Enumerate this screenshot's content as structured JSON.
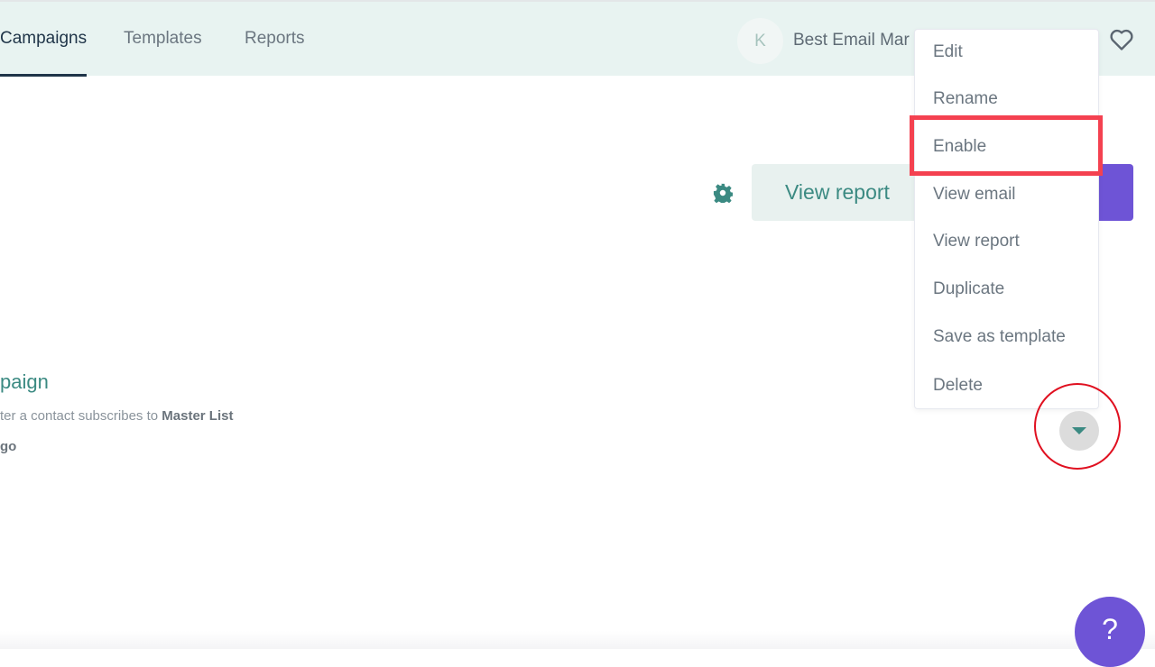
{
  "nav": {
    "tabs": [
      {
        "label": "Campaigns",
        "active": true
      },
      {
        "label": "Templates",
        "active": false
      },
      {
        "label": "Reports",
        "active": false
      }
    ]
  },
  "account": {
    "avatar_initial": "K",
    "name": "Best Email Mar"
  },
  "actions": {
    "view_report_label": "View report"
  },
  "campaign": {
    "title": "paign",
    "description_prefix": "ter a contact subscribes to ",
    "description_list": "Master List",
    "time": "go"
  },
  "dropdown_menu": {
    "items": [
      "Edit",
      "Rename",
      "Enable",
      "View email",
      "View report",
      "Duplicate",
      "Save as template",
      "Delete"
    ],
    "highlighted_item": "Enable"
  },
  "help": {
    "label": "?"
  },
  "colors": {
    "accent_teal": "#3b8a82",
    "brand_purple": "#6e54d6",
    "header_bg": "#e8f3f1",
    "highlight_red": "#f44150",
    "annotation_red": "#e01020"
  }
}
